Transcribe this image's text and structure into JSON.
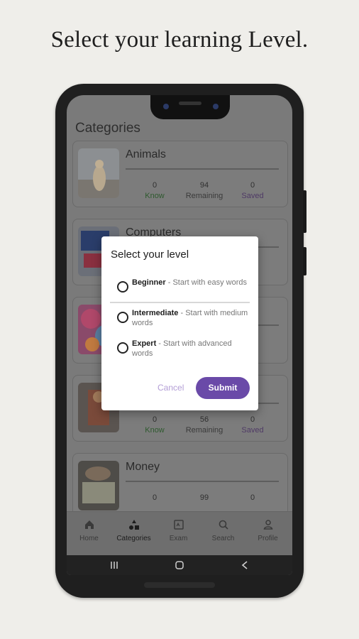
{
  "headline": "Select your learning Level.",
  "app": {
    "title": "Categories",
    "categories": [
      {
        "name": "Animals",
        "know": "0",
        "remaining": "94",
        "saved": "0"
      },
      {
        "name": "Computers"
      },
      {
        "name": ""
      },
      {
        "name": "",
        "know": "0",
        "remaining": "56",
        "saved": "0"
      },
      {
        "name": "Money",
        "know": "0",
        "remaining": "99",
        "saved": "0"
      }
    ],
    "stat_labels": {
      "know": "Know",
      "remaining": "Remaining",
      "saved": "Saved"
    },
    "nav": [
      {
        "label": "Home",
        "icon": "home-icon"
      },
      {
        "label": "Categories",
        "icon": "categories-icon"
      },
      {
        "label": "Exam",
        "icon": "exam-icon"
      },
      {
        "label": "Search",
        "icon": "search-icon"
      },
      {
        "label": "Profile",
        "icon": "profile-icon"
      }
    ],
    "active_nav": "Categories"
  },
  "dialog": {
    "title": "Select your level",
    "options": [
      {
        "name": "Beginner",
        "desc": " - Start with easy words"
      },
      {
        "name": "Intermediate",
        "desc": " - Start with medium words"
      },
      {
        "name": "Expert",
        "desc": " - Start with advanced words"
      }
    ],
    "cancel_label": "Cancel",
    "submit_label": "Submit"
  },
  "colors": {
    "accent": "#6a4aa8",
    "know": "#2f5a2f",
    "saved": "#4f3a66",
    "background": "#efeeea"
  }
}
